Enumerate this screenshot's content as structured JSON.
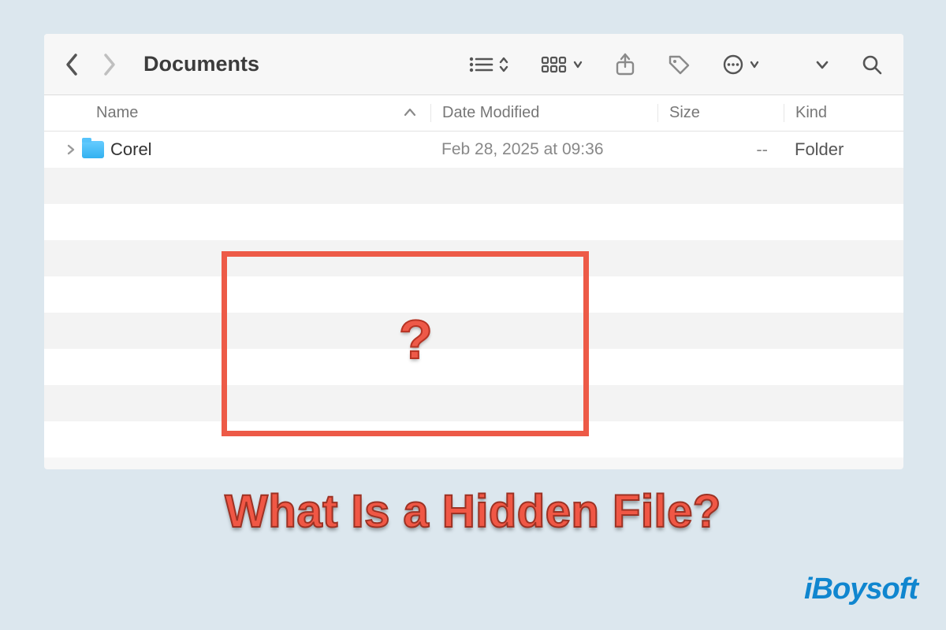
{
  "toolbar": {
    "title": "Documents"
  },
  "headers": {
    "name": "Name",
    "date": "Date Modified",
    "size": "Size",
    "kind": "Kind"
  },
  "rows": [
    {
      "name": "Corel",
      "date": "Feb 28, 2025 at 09:36",
      "size": "--",
      "kind": "Folder"
    }
  ],
  "annotations": {
    "question_mark": "?",
    "caption": "What Is a Hidden File?"
  },
  "branding": {
    "logo": "iBoysoft"
  }
}
